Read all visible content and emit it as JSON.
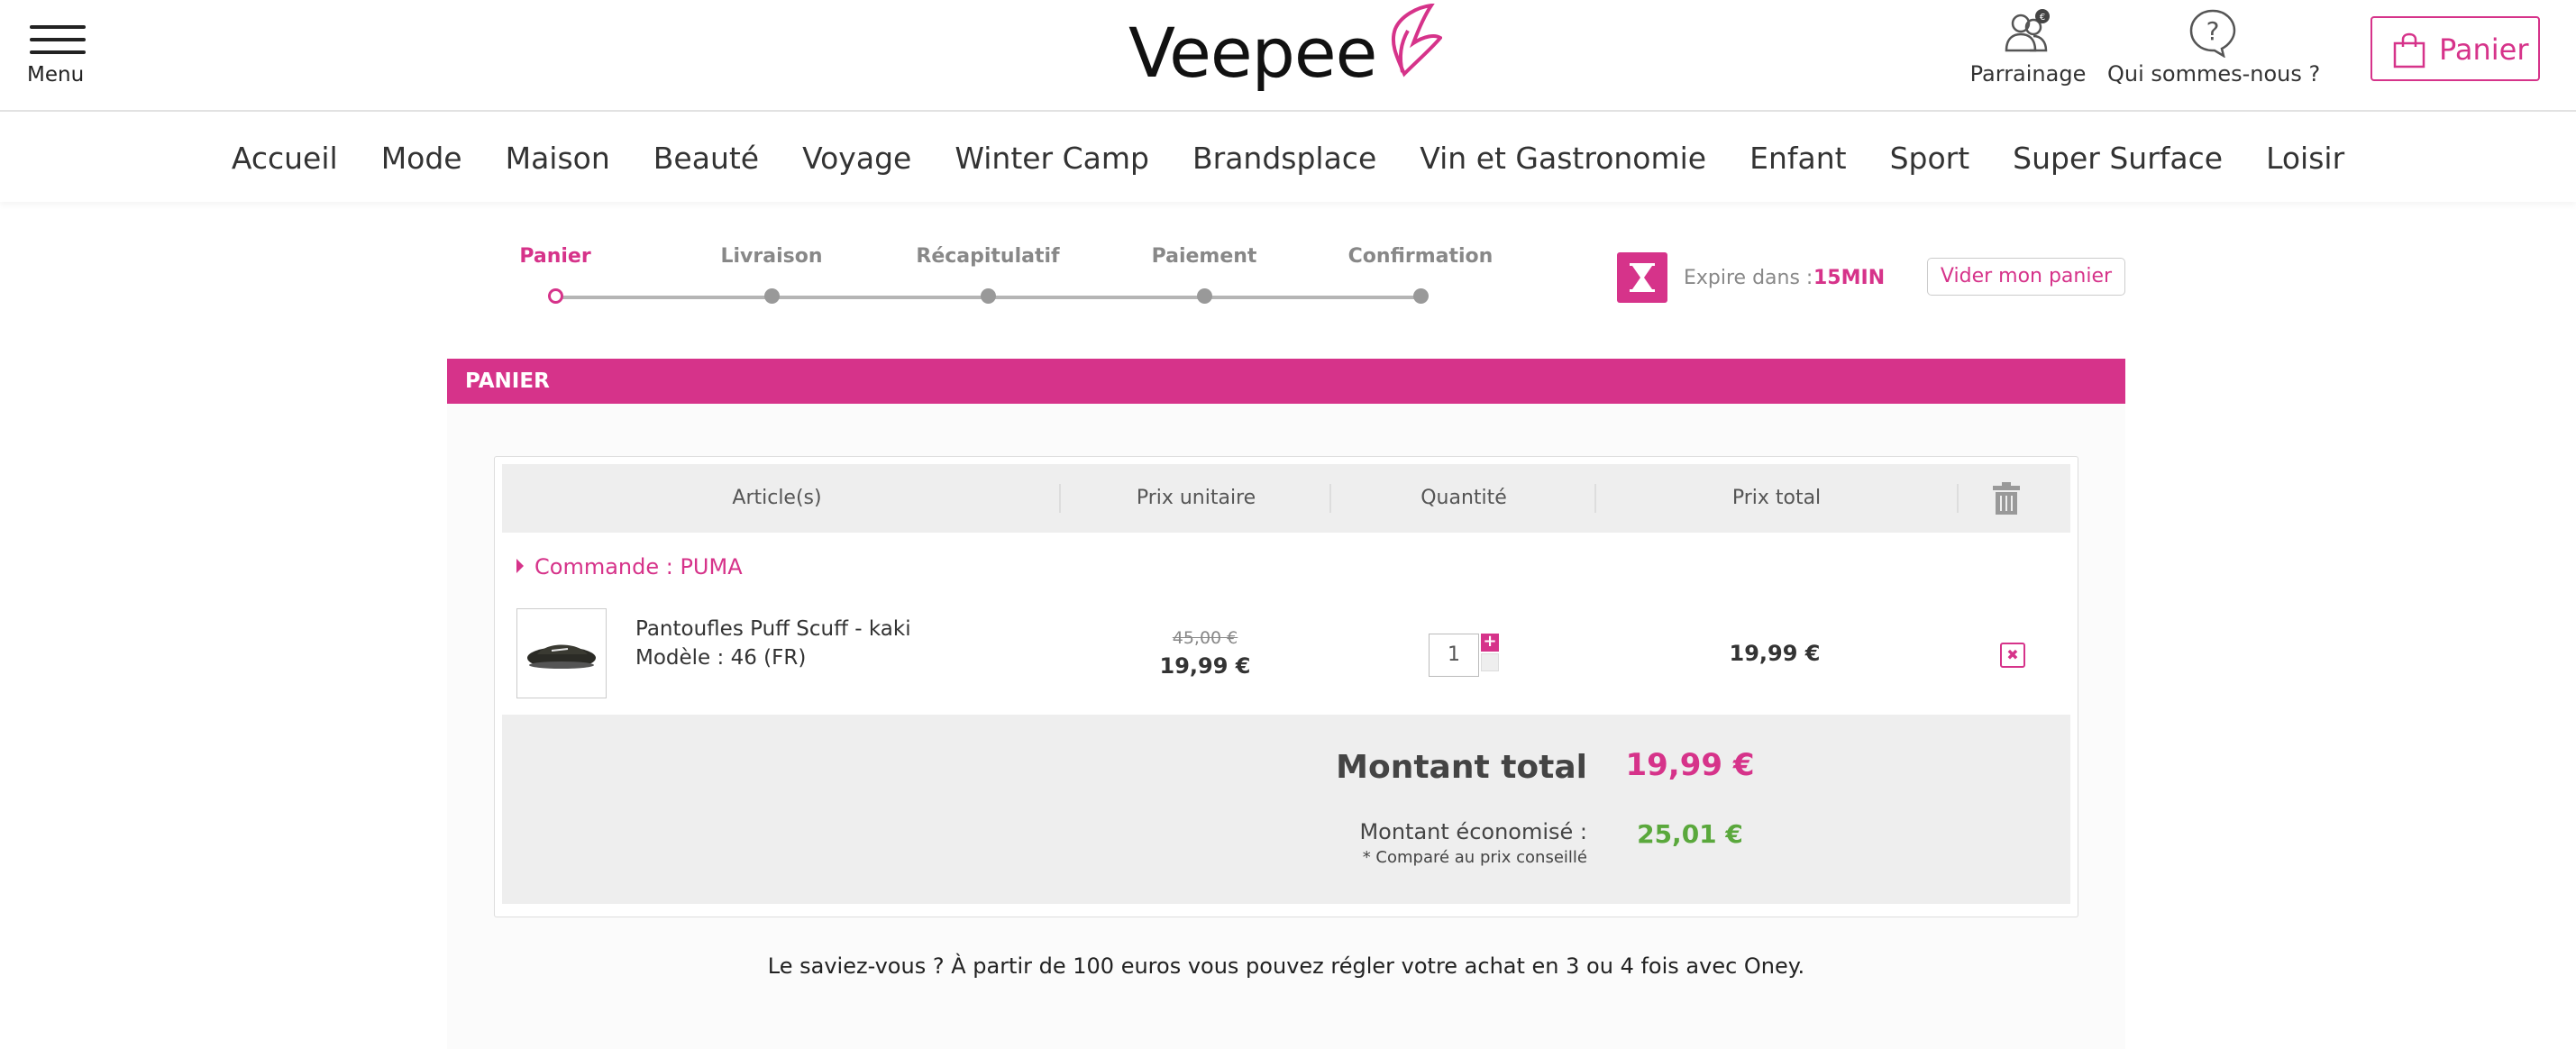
{
  "header": {
    "menu_label": "Menu",
    "logo_text": "Veepee",
    "referral_label": "Parrainage",
    "about_label": "Qui sommes-nous ?",
    "cart_label": "Panier"
  },
  "nav": {
    "items": [
      "Accueil",
      "Mode",
      "Maison",
      "Beauté",
      "Voyage",
      "Winter Camp",
      "Brandsplace",
      "Vin et Gastronomie",
      "Enfant",
      "Sport",
      "Super Surface",
      "Loisir"
    ]
  },
  "stepper": {
    "steps": [
      {
        "label": "Panier",
        "active": true
      },
      {
        "label": "Livraison",
        "active": false
      },
      {
        "label": "Récapitulatif",
        "active": false
      },
      {
        "label": "Paiement",
        "active": false
      },
      {
        "label": "Confirmation",
        "active": false
      }
    ],
    "expire_label": "Expire dans :",
    "expire_time": "15MIN",
    "empty_cart_label": "Vider mon panier"
  },
  "cart": {
    "section_title": "PANIER",
    "columns": [
      "Article(s)",
      "Prix unitaire",
      "Quantité",
      "Prix total"
    ],
    "order_label": "Commande : PUMA",
    "items": [
      {
        "name": "Pantoufles Puff Scuff - kaki",
        "model": "Modèle : 46 (FR)",
        "old_price": "45,00 €",
        "unit_price": "19,99 €",
        "quantity": "1",
        "total_price": "19,99 €"
      }
    ],
    "total_label": "Montant total",
    "total_value": "19,99 €",
    "savings_label": "Montant économisé :",
    "savings_note": "* Comparé au prix conseillé",
    "savings_value": "25,01 €",
    "oney_note": "Le saviez-vous ? À partir de 100 euros vous pouvez régler votre achat en 3 ou 4 fois avec Oney."
  },
  "colors": {
    "accent": "#d6338a",
    "savings": "#5aa83c"
  }
}
